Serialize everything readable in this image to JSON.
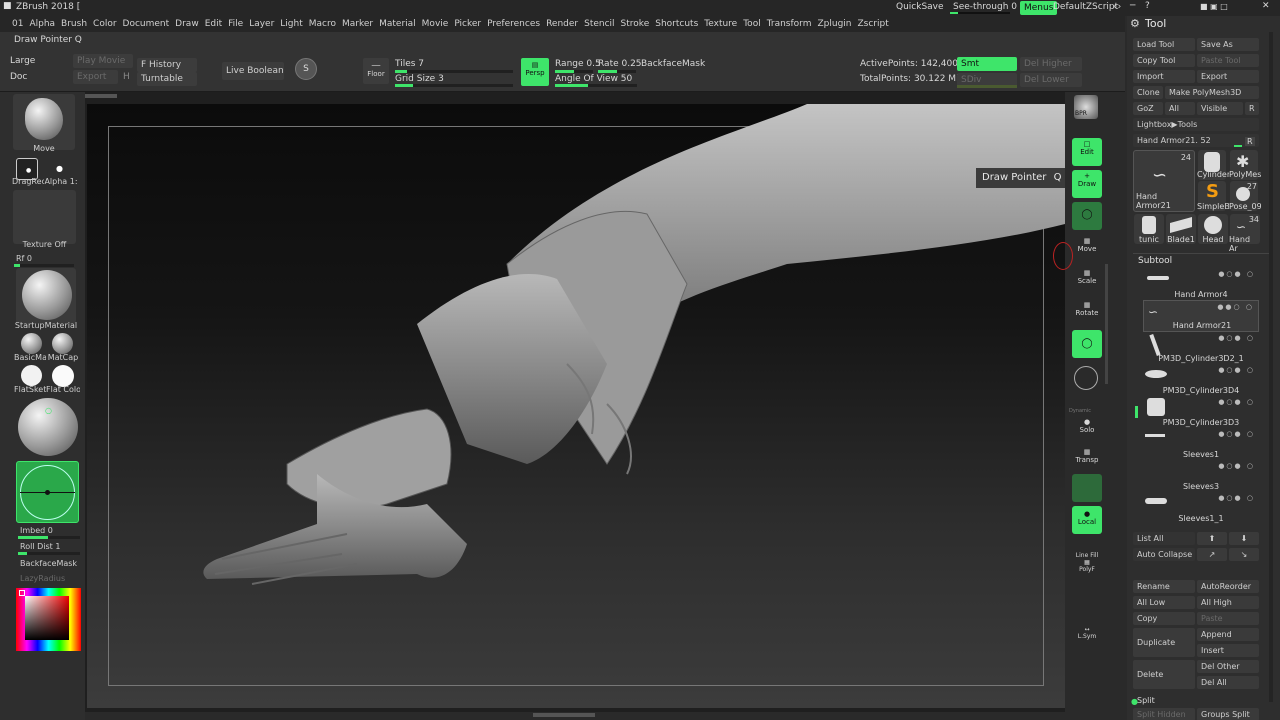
{
  "title": "ZBrush 2018 [",
  "topright": {
    "quicksave": "QuickSave",
    "see_through": "See-through  0",
    "menus": "Menus",
    "default_zscript": "DefaultZScript"
  },
  "menus": [
    "01",
    "Alpha",
    "Brush",
    "Color",
    "Document",
    "Draw",
    "Edit",
    "File",
    "Layer",
    "Light",
    "Macro",
    "Marker",
    "Material",
    "Movie",
    "Picker",
    "Preferences",
    "Render",
    "Stencil",
    "Stroke",
    "Shortcuts",
    "Texture",
    "Tool",
    "Transform",
    "Zplugin",
    "Zscript"
  ],
  "current_tool_label": "Draw Pointer Q",
  "toolbar": {
    "large": "Large",
    "doc": "Doc",
    "play_movie": "Play Movie",
    "export": "Export",
    "h": "H",
    "f_history": "F History",
    "turntable": "Turntable",
    "live_boolean": "Live Boolean",
    "floor": "Floor",
    "tiles": "Tiles 7",
    "grid_size": "Grid Size 3",
    "persp": "Persp",
    "range": "Range 0.5",
    "rate": "Rate 0.25",
    "angle_of_view": "Angle Of View 50",
    "backface_mask": "BackfaceMask",
    "active_points": "ActivePoints: 142,400",
    "total_points": "TotalPoints: 30.122 Mil",
    "smt": "Smt",
    "sdiv": "SDiv",
    "del_higher": "Del Higher",
    "del_lower": "Del Lower",
    "tiles_pct": 0.1,
    "grid_pct": 0.15,
    "range_pct": 0.5,
    "rate_pct": 0.5,
    "aov_pct": 0.4
  },
  "left": {
    "move": "Move",
    "dragrect": "DragRect",
    "alpha": "Alpha 1:",
    "texture_off": "Texture Off",
    "rf": "Rf 0",
    "startup_material": "StartupMaterial",
    "basic": "BasicMa",
    "matcap": "MatCap",
    "flatsket": "FlatSket",
    "flat_color": "Flat Colo",
    "imbed": "Imbed 0",
    "roll_dist": "Roll Dist 1",
    "backface_mask": "BackfaceMask",
    "lazy_radius": "LazyRadius"
  },
  "tooltip": {
    "label": "Draw Pointer",
    "key": "Q"
  },
  "shelf": [
    "BPR",
    "Edit",
    "Draw",
    "Move",
    "Scale",
    "Rotate",
    "Dynamic",
    "Solo",
    "Transp",
    "Local",
    "Line Fill",
    "PolyF",
    "L.Sym"
  ],
  "tool": {
    "header": "Tool",
    "load_tool": "Load Tool",
    "save_as": "Save As",
    "copy_tool": "Copy Tool",
    "paste_tool": "Paste Tool",
    "import": "Import",
    "export": "Export",
    "clone": "Clone",
    "make_polymesh": "Make PolyMesh3D",
    "goz": "GoZ",
    "all": "All",
    "visible": "Visible",
    "r": "R",
    "lightbox": "Lightbox▶Tools",
    "hand_armor_slider": "Hand Armor21. 52",
    "thumbs": [
      {
        "label": "Hand Armor21",
        "count": "24"
      },
      {
        "label": "Cylinder",
        "count": ""
      },
      {
        "label": "PolyMes",
        "count": ""
      },
      {
        "label": "SimpleB",
        "count": ""
      },
      {
        "label": "Pose_09",
        "count": "27"
      },
      {
        "label": "tunic",
        "count": ""
      },
      {
        "label": "Blade1",
        "count": ""
      },
      {
        "label": "Head",
        "count": ""
      },
      {
        "label": "Hand Ar",
        "count": "34"
      }
    ],
    "subtool_header": "Subtool",
    "subtools": [
      "Hand Armor4",
      "Hand Armor21",
      "PM3D_Cylinder3D2_1",
      "PM3D_Cylinder3D4",
      "PM3D_Cylinder3D3",
      "Sleeves1",
      "Sleeves3",
      "Sleeves1_1"
    ],
    "list_all": "List All",
    "auto_collapse": "Auto Collapse",
    "rename": "Rename",
    "auto_reorder": "AutoReorder",
    "all_low": "All Low",
    "all_high": "All High",
    "copy": "Copy",
    "paste": "Paste",
    "duplicate": "Duplicate",
    "append": "Append",
    "insert": "Insert",
    "delete": "Delete",
    "del_other": "Del Other",
    "del_all": "Del All",
    "split": "Split",
    "split_hidden": "Split Hidden",
    "groups_split": "Groups Split"
  }
}
